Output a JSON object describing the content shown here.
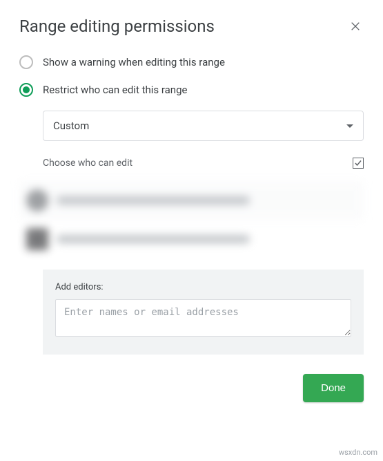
{
  "dialog": {
    "title": "Range editing permissions"
  },
  "options": {
    "warning_label": "Show a warning when editing this range",
    "restrict_label": "Restrict who can edit this range",
    "selected": "restrict"
  },
  "restrict": {
    "select_value": "Custom",
    "choose_label": "Choose who can edit",
    "select_all_checked": true
  },
  "add_editors": {
    "label": "Add editors:",
    "placeholder": "Enter names or email addresses",
    "value": ""
  },
  "footer": {
    "done_label": "Done"
  },
  "watermark": "wsxdn.com"
}
